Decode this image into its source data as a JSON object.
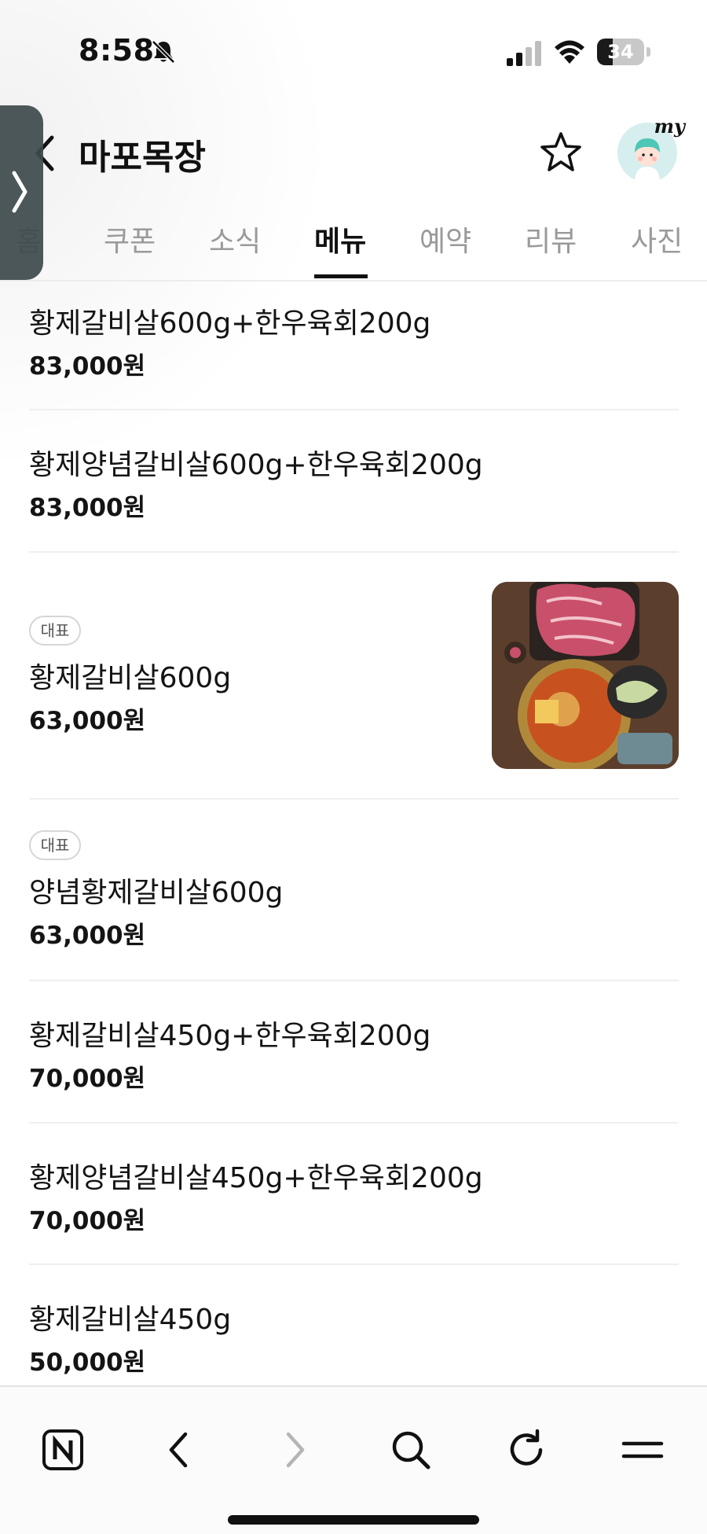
{
  "status_bar": {
    "time": "8:58",
    "battery": "34",
    "battery_level": 0.34
  },
  "header": {
    "title": "마포목장"
  },
  "tabs": [
    {
      "label": "홈"
    },
    {
      "label": "쿠폰"
    },
    {
      "label": "소식"
    },
    {
      "label": "메뉴",
      "active": true
    },
    {
      "label": "예약"
    },
    {
      "label": "리뷰"
    },
    {
      "label": "사진"
    }
  ],
  "avatar": {
    "label": "my"
  },
  "menu": [
    {
      "name": "황제갈비살600g+한우육회200g",
      "price": "83,000원"
    },
    {
      "name": "황제양념갈비살600g+한우육회200g",
      "price": "83,000원"
    },
    {
      "badge": "대표",
      "name": "황제갈비살600g",
      "price": "63,000원",
      "has_photo": true
    },
    {
      "badge": "대표",
      "name": "양념황제갈비살600g",
      "price": "63,000원"
    },
    {
      "name": "황제갈비살450g+한우육회200g",
      "price": "70,000원"
    },
    {
      "name": "황제양념갈비살450g+한우육회200g",
      "price": "70,000원"
    },
    {
      "name": "황제갈비살450g",
      "price": "50,000원"
    }
  ],
  "toolbar": {
    "icons": [
      "naver-home-icon",
      "back-icon",
      "forward-icon",
      "search-icon",
      "refresh-icon",
      "menu-icon"
    ]
  },
  "colors": {
    "text": "#141414",
    "muted_tab": "#9a9a9a",
    "divider": "#efefef",
    "side_handle": "#3e4a4d"
  }
}
